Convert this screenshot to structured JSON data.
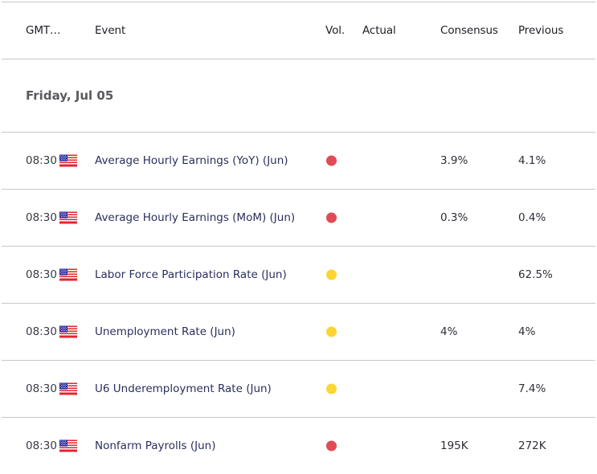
{
  "header": {
    "time": "GMT…",
    "event": "Event",
    "vol": "Vol.",
    "actual": "Actual",
    "consensus": "Consensus",
    "previous": "Previous"
  },
  "date_label": "Friday, Jul 05",
  "volatility_colors": {
    "high": "#e04b55",
    "medium": "#fcd535"
  },
  "events": [
    {
      "time": "08:30",
      "country_icon": "us-flag-icon",
      "event": "Average Hourly Earnings (YoY) (Jun)",
      "volatility": "high",
      "actual": "",
      "consensus": "3.9%",
      "previous": "4.1%"
    },
    {
      "time": "08:30",
      "country_icon": "us-flag-icon",
      "event": "Average Hourly Earnings (MoM) (Jun)",
      "volatility": "high",
      "actual": "",
      "consensus": "0.3%",
      "previous": "0.4%"
    },
    {
      "time": "08:30",
      "country_icon": "us-flag-icon",
      "event": "Labor Force Participation Rate (Jun)",
      "volatility": "medium",
      "actual": "",
      "consensus": "",
      "previous": "62.5%"
    },
    {
      "time": "08:30",
      "country_icon": "us-flag-icon",
      "event": "Unemployment Rate (Jun)",
      "volatility": "medium",
      "actual": "",
      "consensus": "4%",
      "previous": "4%"
    },
    {
      "time": "08:30",
      "country_icon": "us-flag-icon",
      "event": "U6 Underemployment Rate (Jun)",
      "volatility": "medium",
      "actual": "",
      "consensus": "",
      "previous": "7.4%"
    },
    {
      "time": "08:30",
      "country_icon": "us-flag-icon",
      "event": "Nonfarm Payrolls (Jun)",
      "volatility": "high",
      "actual": "",
      "consensus": "195K",
      "previous": "272K"
    }
  ]
}
